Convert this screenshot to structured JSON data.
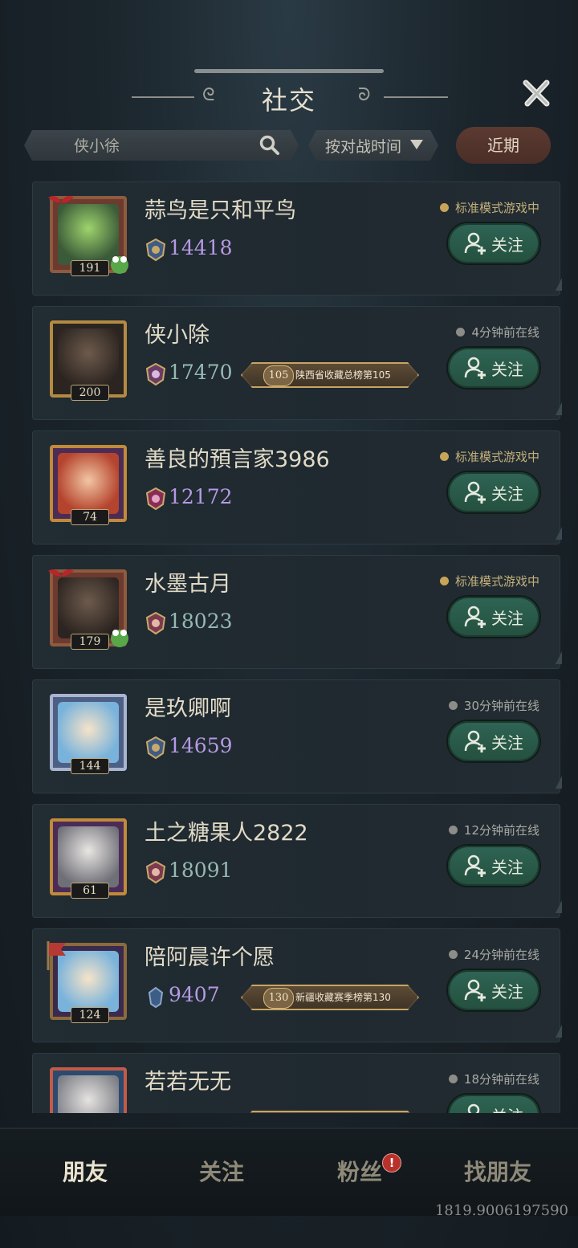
{
  "header": {
    "title": "社交"
  },
  "search": {
    "placeholder": "侠小徐"
  },
  "sort": {
    "label": "按对战时间"
  },
  "filter": {
    "recent_label": "近期"
  },
  "colors": {
    "accent_green": "#2f6454",
    "in_game": "#c7a457",
    "offline": "#8c8c88",
    "score_purple": "#b59ae3",
    "score_teal": "#97b9b3"
  },
  "friends": [
    {
      "name": "蒜鸟是只和平鸟",
      "level": "191",
      "score": "14418",
      "status": "标准模式游戏中",
      "follow": "关注"
    },
    {
      "name": "侠小除",
      "level": "200",
      "score": "17470",
      "rank_num": "105",
      "rank_text": "陕西省收藏总榜第105",
      "status": "4分钟前在线",
      "follow": "关注"
    },
    {
      "name": "善良的預言家3986",
      "level": "74",
      "score": "12172",
      "status": "标准模式游戏中",
      "follow": "关注"
    },
    {
      "name": "水墨古月",
      "level": "179",
      "score": "18023",
      "status": "标准模式游戏中",
      "follow": "关注"
    },
    {
      "name": "是玖卿啊",
      "level": "144",
      "score": "14659",
      "status": "30分钟前在线",
      "follow": "关注"
    },
    {
      "name": "土之糖果人2822",
      "level": "61",
      "score": "18091",
      "status": "12分钟前在线",
      "follow": "关注"
    },
    {
      "name": "陪阿晨许个愿",
      "level": "124",
      "score": "9407",
      "rank_num": "130",
      "rank_text": "新疆收藏赛季榜第130",
      "status": "24分钟前在线",
      "follow": "关注"
    },
    {
      "name": "若若无无",
      "status": "18分钟前在线",
      "follow": "关注"
    }
  ],
  "nav": {
    "friends": "朋友",
    "following": "关注",
    "fans": "粉丝",
    "fans_badge": "!",
    "find": "找朋友"
  },
  "footer": {
    "id": "1819.9006197590"
  }
}
